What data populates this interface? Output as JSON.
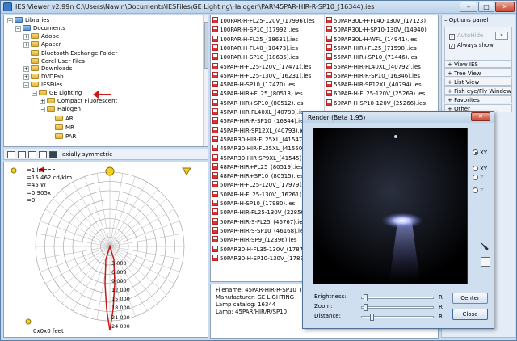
{
  "window": {
    "title": "IES Viewer v2.99n   C:\\Users\\Nawin\\Documents\\IESFiles\\GE Lighting\\Halogen\\PAR\\45PAR-HIR-R-SP10_(16344).ies",
    "min_label": "–",
    "max_label": "□",
    "close_label": "✕"
  },
  "tree": {
    "items": [
      {
        "label": "Libraries",
        "expander": "−",
        "icon": "library-icon"
      },
      {
        "label": "Documents",
        "expander": "−",
        "icon": "library-icon"
      },
      {
        "label": "Adobe",
        "expander": "+",
        "icon": "folder-icon"
      },
      {
        "label": "Apacer",
        "expander": "+",
        "icon": "folder-icon"
      },
      {
        "label": "Bluetooth Exchange Folder",
        "expander": "",
        "icon": "folder-icon"
      },
      {
        "label": "Corel User Files",
        "expander": "",
        "icon": "folder-icon"
      },
      {
        "label": "Downloads",
        "expander": "+",
        "icon": "folder-icon"
      },
      {
        "label": "DVDFab",
        "expander": "+",
        "icon": "folder-icon"
      },
      {
        "label": "IESFiles",
        "expander": "−",
        "icon": "folder-icon"
      },
      {
        "label": "GE Lighting",
        "expander": "−",
        "icon": "folder-icon"
      },
      {
        "label": "Compact Fluorescent",
        "expander": "+",
        "icon": "folder-icon"
      },
      {
        "label": "Halogen",
        "expander": "−",
        "icon": "folder-icon"
      },
      {
        "label": "AR",
        "expander": "",
        "icon": "folder-icon"
      },
      {
        "label": "MR",
        "expander": "",
        "icon": "folder-icon"
      },
      {
        "label": "PAR",
        "expander": "",
        "icon": "folder-icon"
      }
    ]
  },
  "toolbar": {
    "axially_label": "axially symmetric"
  },
  "polar": {
    "legend": [
      {
        "label": "=1 lm",
        "icon": "bulb-icon"
      },
      {
        "label": "=15 462 cd/klm",
        "icon": "peak-icon"
      },
      {
        "label": "=45 W",
        "icon": "watt-icon"
      },
      {
        "label": "=0,905x",
        "icon": "factor-icon"
      },
      {
        "label": "=0",
        "icon": "angle-icon"
      }
    ],
    "ticks": [
      "3 000",
      "6 000",
      "9 000",
      "12 000",
      "15 000",
      "18 000",
      "21 000",
      "24 000"
    ],
    "scale_label": "0x0x0 feet"
  },
  "files": {
    "col1": [
      "100PAR-H-FL25-120V_(17996).ies",
      "100PAR-H-SP10_(17992).ies",
      "100PAR-H-FL25_(18631).ies",
      "100PAR-H-FL40_(10473).ies",
      "100PAR-H-SP10_(18635).ies",
      "45PAR-H-FL25-120V_(17471).ies",
      "45PAR-H-FL25-130V_(16231).ies",
      "45PAR-H-SP10_(17470).ies",
      "45PAR-HIR+FL25_(80513).ies",
      "45PAR-HIR+SP10_(80512).ies",
      "45PAR-HIR-FL40XL_(40790).ies",
      "45PAR-HIR-R-SP10_(16344).ies",
      "45PAR-HIR-SP12XL_(40793).ies",
      "45PAR30-HIR-FL25XL_(41547).ies",
      "45PAR30-HIR-FL35XL_(41550).ies",
      "45PAR30-HIR-SP9XL_(41545).ies",
      "48PAR-HIR+FL25_(80519).ies",
      "48PAR-HIR+SP10_(80515).ies",
      "50PAR-H-FL25-120V_(17979).ies",
      "50PAR-H-FL25-130V_(16261).ies",
      "50PAR-H-SP10_(17980).ies",
      "50PAR-HIR-FL25-130V_(22850).ies",
      "50PAR-HIR-S-FL25_(46767).ies",
      "50PAR-HIR-S-SP10_(46168).ies",
      "50PAR-HIR-SP9_(12396).ies",
      "50PAR30-H-FL35-130V_(17874).ies",
      "50PAR30-H-SP10-130V_(17870).ies"
    ],
    "col2": [
      "50PAR30L-H-FL40-130V_(17123)",
      "50PAR30L-H-SP10-130V_(14940)",
      "50PAR30L-H-WFL_(14941).ies",
      "55PAR-HIR+FL25_(71598).ies",
      "55PAR-HIR+SP10_(71446).ies",
      "55PAR-HIR-FL40XL_(40792).ies",
      "55PAR-HIR-R-SP10_(16346).ies",
      "55PAR-HIR-SP12XL_(40794).ies",
      "60PAR-H-FL25-120V_(25269).ies",
      "60PAR-H-SP10-120V_(25266).ies"
    ]
  },
  "info": {
    "filename": "Filename: 45PAR-HIR-R-SP10_(16344).ies",
    "manufacturer": "Manufacturer: GE LIGHTING",
    "catalog": "Lamp catalog: 16344",
    "lamp": "Lamp: 45PAR/HIR/R/SP10"
  },
  "options": {
    "header": "– Options panel",
    "autohide": "AutoHide",
    "always_show": "Always show",
    "pin_label": "»",
    "items": [
      "+ View IES",
      "+ Tree View",
      "+ List View",
      "+ Fish eye/Fly Window",
      "+ Favorites",
      "+ Other"
    ]
  },
  "render": {
    "title": "Render (Beta 1.95)",
    "close_label": "✕",
    "radios": [
      {
        "label": "XY",
        "checked": true,
        "enabled": true
      },
      {
        "label": "XY",
        "checked": false,
        "enabled": true
      },
      {
        "label": "Z",
        "checked": false,
        "enabled": false
      },
      {
        "label": "Z",
        "checked": false,
        "enabled": false
      }
    ],
    "brightness_label": "Brightness:",
    "zoom_label": "Zoom:",
    "distance_label": "Distance:",
    "r_label": "R",
    "center_button": "Center",
    "close_button": "Close"
  }
}
